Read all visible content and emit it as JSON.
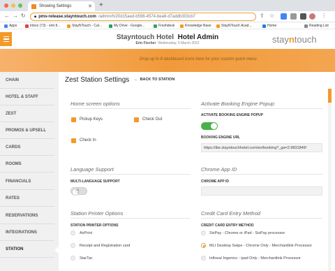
{
  "browser": {
    "tab_title": "Showing Settings",
    "url_host": "pms-release.stayntouch.com",
    "url_path": "/admin/h/20d15aed-b598-4574-bea6-d7addb303cb7",
    "bookmarks": [
      "Apps",
      "Inbox (73) - erin.fi...",
      "StayNTouch - Cal...",
      "My Drive - Google...",
      "Freshdesk",
      "Knowledge Base",
      "StayNTouch Acad...",
      "Home"
    ],
    "reading_list": "Reading List"
  },
  "header": {
    "hotel_name": "Stayntouch Hotel",
    "admin_label": "Hotel Admin",
    "user_name": "Erin Fischer",
    "date": "Wednesday, 9 March 2022",
    "logo_prefix": "stay",
    "logo_n": "n",
    "logo_suffix": "touch"
  },
  "banner": {
    "hint": "Drop up to 8 dashboard icons here for your custom quick menu"
  },
  "sidebar": {
    "items": [
      {
        "label": "CHAIN"
      },
      {
        "label": "HOTEL & STAFF"
      },
      {
        "label": "ZEST"
      },
      {
        "label": "PROMOS & UPSELL"
      },
      {
        "label": "CARDS"
      },
      {
        "label": "ROOMS"
      },
      {
        "label": "FINANCIALS"
      },
      {
        "label": "RATES"
      },
      {
        "label": "RESERVATIONS"
      },
      {
        "label": "INTEGRATIONS"
      },
      {
        "label": "STATION"
      }
    ]
  },
  "main": {
    "title": "Zest Station Settings",
    "back_label": "BACK TO STATION",
    "home_screen": {
      "title": "Home screen options",
      "options": [
        "Pickup Keys",
        "Check Out",
        "Check In"
      ]
    },
    "booking_engine": {
      "title": "Activate Booking Engine Popup",
      "toggle_label": "ACTIVATE BOOKING ENGINE POPUP",
      "toggle_on": true,
      "url_label": "BOOKING ENGINE URL",
      "url_value": "https://ibe.stayntouchhotel.com/en/booking?_ga=2.9831849!"
    },
    "language": {
      "title": "Language Support",
      "toggle_label": "MULTI-LANGUAGE SUPPORT",
      "toggle_on": false
    },
    "chrome_app": {
      "title": "Chrome App ID",
      "field_label": "CHROME APP ID",
      "value": ""
    },
    "printer": {
      "title": "Station Printer Options",
      "field_label": "STATION PRINTER OPTIONS",
      "options": [
        "AirPrint",
        "Receipt and Registration card",
        "StarTac"
      ]
    },
    "credit_card": {
      "title": "Credit Card Entry Method",
      "field_label": "CREDIT CARD ENTRY METHOD",
      "options": [
        "SixPay - Chrome or iPad - SixPay processor",
        "MLI Desktop Swipe - Chrome Only - Merchantlink Processor",
        "Infinea/ Ingenico - ipad Only - Merchantlink Processor"
      ],
      "selected_index": 1
    }
  },
  "colors": {
    "accent": "#f29a29",
    "toggle_on": "#4ab04a"
  }
}
